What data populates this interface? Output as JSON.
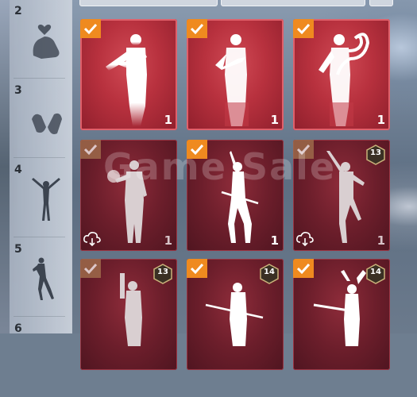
{
  "wheel": {
    "slots": [
      {
        "number": "2",
        "icon": "hand-heart-icon"
      },
      {
        "number": "3",
        "icon": "cupped-hands-icon"
      },
      {
        "number": "4",
        "icon": "arms-raised-figure-icon"
      },
      {
        "number": "5",
        "icon": "dancing-figure-icon"
      },
      {
        "number": "6",
        "icon": ""
      }
    ]
  },
  "emotes": [
    {
      "selected": true,
      "count": "1",
      "level": "",
      "downloadable": false,
      "style": "bright",
      "pose": "arm-cross"
    },
    {
      "selected": true,
      "count": "1",
      "level": "",
      "downloadable": false,
      "style": "bright",
      "pose": "arms-folded"
    },
    {
      "selected": true,
      "count": "1",
      "level": "",
      "downloadable": false,
      "style": "bright",
      "pose": "snake"
    },
    {
      "selected": true,
      "count": "1",
      "level": "",
      "downloadable": true,
      "style": "dark",
      "pose": "orb"
    },
    {
      "selected": true,
      "count": "1",
      "level": "",
      "downloadable": false,
      "style": "dark",
      "pose": "spear-dance"
    },
    {
      "selected": true,
      "count": "1",
      "level": "13",
      "downloadable": true,
      "style": "dark",
      "pose": "kick"
    },
    {
      "selected": true,
      "count": "",
      "level": "13",
      "downloadable": false,
      "style": "dark",
      "pose": "gun"
    },
    {
      "selected": true,
      "count": "",
      "level": "14",
      "downloadable": false,
      "style": "dark",
      "pose": "sword"
    },
    {
      "selected": true,
      "count": "",
      "level": "14",
      "downloadable": false,
      "style": "dark",
      "pose": "rifle-up"
    }
  ],
  "watermark": "Game Sale",
  "colors": {
    "check": "#ef8a1f",
    "card_bright": "#c23a47",
    "card_dark": "#6c1e2b"
  }
}
